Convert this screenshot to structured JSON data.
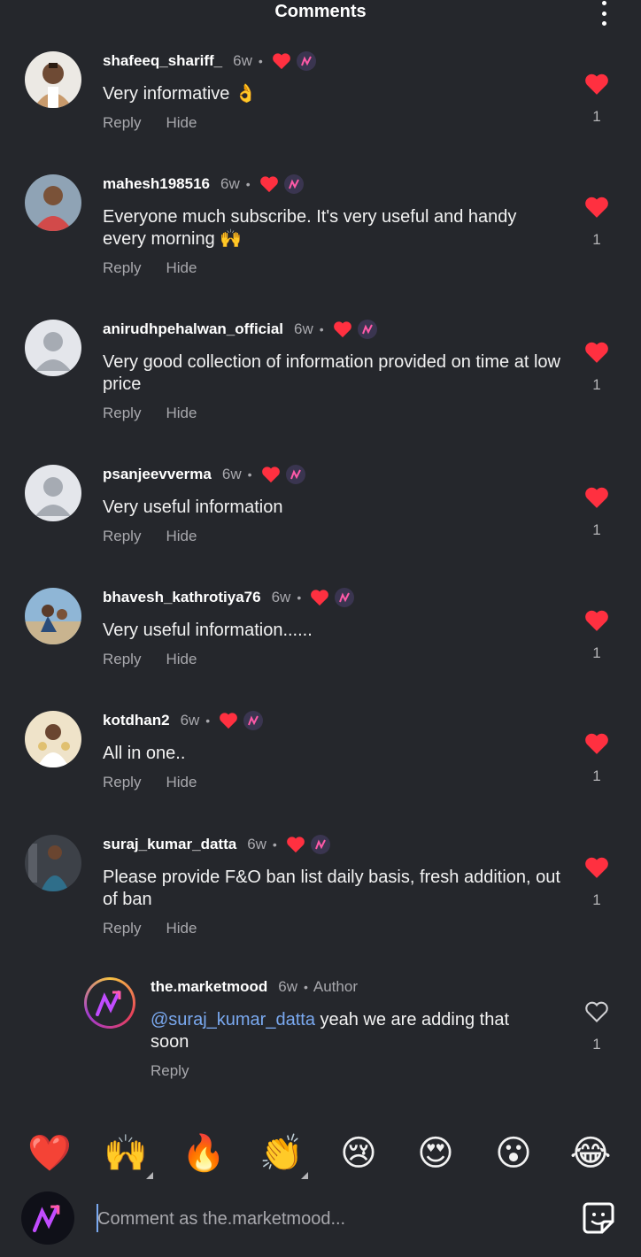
{
  "header": {
    "title": "Comments"
  },
  "comments": [
    {
      "username": "shafeeq_shariff_",
      "time": "6w",
      "dot": "•",
      "text": "Very informative 👌",
      "reply": "Reply",
      "hide": "Hide",
      "likes": "1",
      "liked": true
    },
    {
      "username": "mahesh198516",
      "time": "6w",
      "dot": "•",
      "text": "Everyone much subscribe. It's very useful and handy every morning 🙌",
      "reply": "Reply",
      "hide": "Hide",
      "likes": "1",
      "liked": true
    },
    {
      "username": "anirudhpehalwan_official",
      "time": "6w",
      "dot": "•",
      "text": "Very good collection of information provided on time at low price",
      "reply": "Reply",
      "hide": "Hide",
      "likes": "1",
      "liked": true
    },
    {
      "username": "psanjeevverma",
      "time": "6w",
      "dot": "•",
      "text": "Very useful information",
      "reply": "Reply",
      "hide": "Hide",
      "likes": "1",
      "liked": true
    },
    {
      "username": "bhavesh_kathrotiya76",
      "time": "6w",
      "dot": "•",
      "text": "Very useful information......",
      "reply": "Reply",
      "hide": "Hide",
      "likes": "1",
      "liked": true
    },
    {
      "username": "kotdhan2",
      "time": "6w",
      "dot": "•",
      "text": "All in one..",
      "reply": "Reply",
      "hide": "Hide",
      "likes": "1",
      "liked": true
    },
    {
      "username": "suraj_kumar_datta",
      "time": "6w",
      "dot": "•",
      "text": "Please provide F&O ban list daily basis, fresh addition, out of ban",
      "reply": "Reply",
      "hide": "Hide",
      "likes": "1",
      "liked": true
    }
  ],
  "author_reply": {
    "username": "the.marketmood",
    "time": "6w",
    "dot": "•",
    "author_label": "Author",
    "mention": "@suraj_kumar_datta",
    "text": " yeah we are adding that soon",
    "reply": "Reply",
    "likes": "1",
    "liked": false
  },
  "emoji_bar": [
    "❤️",
    "🙌",
    "🔥",
    "👏",
    "😢",
    "😍",
    "😮",
    "😂"
  ],
  "composer": {
    "placeholder": "Comment as the.marketmood..."
  },
  "colors": {
    "background": "#25272c",
    "heart": "#ff3040",
    "mention": "#7aa9f0",
    "muted": "#a8a8ad"
  },
  "icons": {
    "more": "more-vertical-icon",
    "heart": "heart-icon",
    "sticker": "sticker-icon"
  }
}
